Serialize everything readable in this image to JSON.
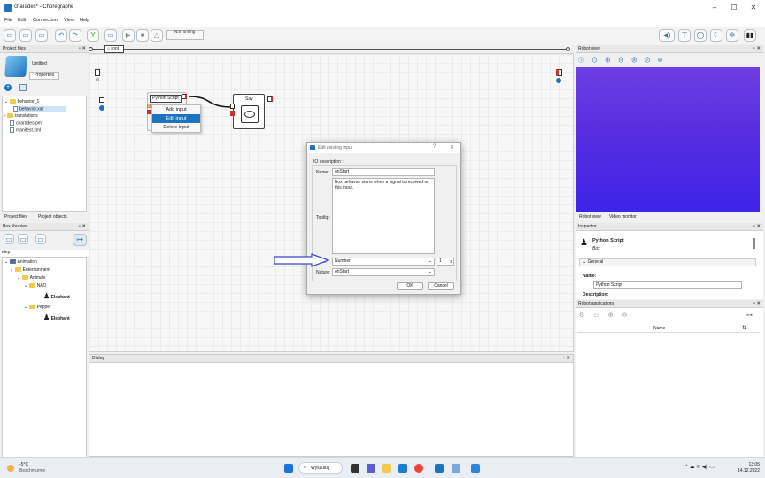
{
  "window": {
    "title": "charades* - Choregraphe"
  },
  "menu": [
    "File",
    "Edit",
    "Connection",
    "View",
    "Help"
  ],
  "toolbar": {
    "status": "Not running"
  },
  "path": {
    "root_label": "root"
  },
  "project_files": {
    "header": "Project files",
    "project_name": "Untitled",
    "properties_label": "Properties",
    "tree": [
      {
        "label": "behavior_1",
        "kind": "folder"
      },
      {
        "label": "behavior.xar",
        "kind": "file",
        "selected": true
      },
      {
        "label": "translations",
        "kind": "folder"
      },
      {
        "label": "charades.pml",
        "kind": "file"
      },
      {
        "label": "manifest.xml",
        "kind": "file"
      }
    ],
    "tabs": [
      "Project files",
      "Project objects"
    ]
  },
  "box_libraries": {
    "header": "Box libraries",
    "search_value": "elep",
    "tree": [
      {
        "label": "Animation"
      },
      {
        "label": "Entertainment"
      },
      {
        "label": "Animals"
      },
      {
        "label": "NAO"
      },
      {
        "label": "Elephant"
      },
      {
        "label": "Pepper"
      },
      {
        "label": "Elephant"
      }
    ]
  },
  "flow": {
    "python_box_label": "Python Script",
    "say_box_label": "Say",
    "context_menu": [
      "Add input",
      "Edit input",
      "Delete input"
    ],
    "context_selected": "Edit input"
  },
  "dialog": {
    "title": "Edit existing input",
    "help": "?",
    "close": "✕",
    "section": "IO description :",
    "name_label": "Name:",
    "name_value": "onStart",
    "tooltip_label": "Tooltip:",
    "tooltip_value": "Box behavior starts when a signal is received on this input.",
    "type_label": "Type:",
    "type_value": "Number",
    "type_count": "1",
    "nature_label": "Nature:",
    "nature_value": "onStart",
    "ok": "OK",
    "cancel": "Cancel"
  },
  "dialog_panel": {
    "header": "Dialog"
  },
  "robot_view": {
    "header": "Robot view",
    "tabs": [
      "Robot view",
      "Video monitor"
    ]
  },
  "inspector": {
    "header": "Inspector",
    "box_name": "Python Script",
    "box_type": "Box",
    "section": "General",
    "name_label": "Name:",
    "name_value": "Python Script",
    "description_label": "Description:"
  },
  "robot_apps": {
    "header": "Robot applications",
    "column_name": "Name"
  },
  "taskbar": {
    "weather_temp": "-5°C",
    "weather_desc": "Bezchmurnie",
    "search": "Wyszukaj",
    "time": "13:05",
    "date": "14.12.2022"
  },
  "colors": {
    "accent": "#1e73be",
    "robot_view_bg": "#4a2be6",
    "arrow": "#3b46c9"
  }
}
